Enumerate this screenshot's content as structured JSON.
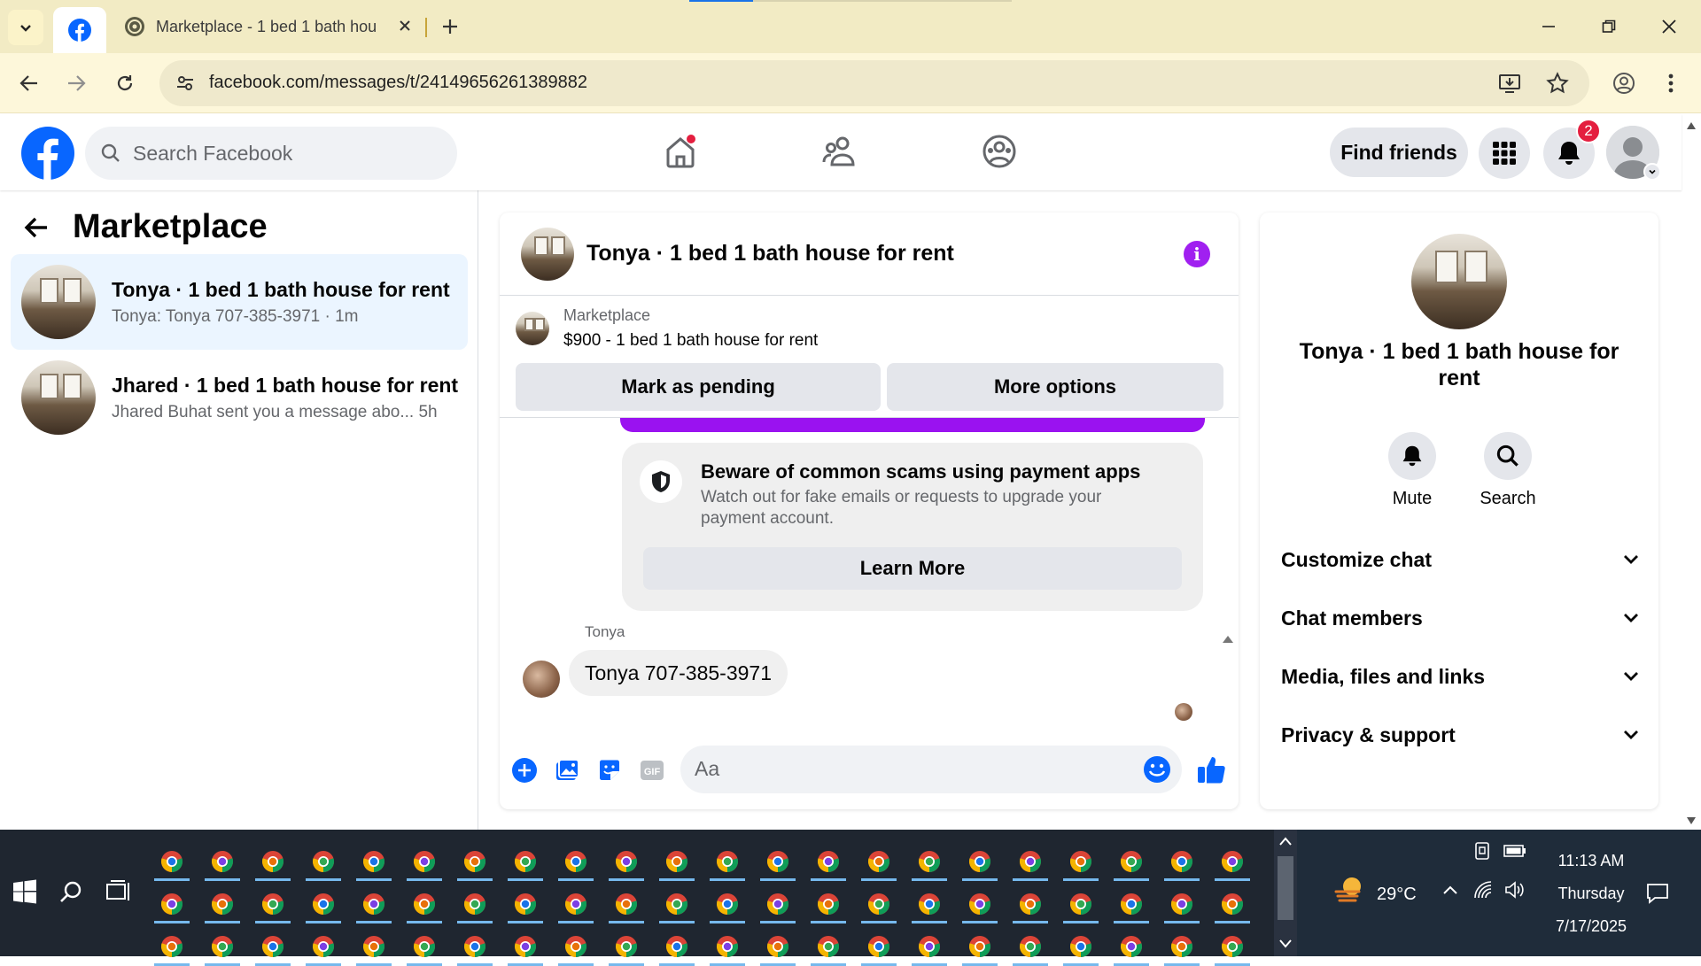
{
  "browser": {
    "tabs": [
      {
        "title": "",
        "icon": "facebook-icon"
      },
      {
        "title": "Marketplace - 1 bed 1 bath hou",
        "icon": "marketplace-favicon"
      }
    ],
    "url": "facebook.com/messages/t/24149656261389882"
  },
  "fb_header": {
    "search_placeholder": "Search Facebook",
    "find_friends_label": "Find friends",
    "notification_count": "2"
  },
  "left_panel": {
    "title": "Marketplace",
    "conversations": [
      {
        "name": "Tonya · 1 bed 1 bath house for rent",
        "preview": "Tonya: Tonya 707-385-3971 · 1m",
        "active": true
      },
      {
        "name": "Jhared · 1 bed 1 bath house for rent",
        "preview": "Jhared Buhat sent you a message abo...  5h",
        "active": false
      }
    ]
  },
  "chat": {
    "title": "Tonya · 1 bed 1 bath house for rent",
    "marketplace_label": "Marketplace",
    "listing": "$900 - 1 bed 1 bath house for rent",
    "mark_pending_label": "Mark as pending",
    "more_options_label": "More options",
    "scam_notice": {
      "heading": "Beware of common scams using payment apps",
      "body": "Watch out for fake emails or requests to upgrade your payment account.",
      "button": "Learn More"
    },
    "messages": [
      {
        "sender": "Tonya",
        "text": "Tonya 707-385-3971"
      }
    ],
    "composer_placeholder": "Aa"
  },
  "info_panel": {
    "title": "Tonya · 1 bed 1 bath house for rent",
    "actions": [
      {
        "label": "Mute",
        "icon": "bell-icon"
      },
      {
        "label": "Search",
        "icon": "search-icon"
      }
    ],
    "sections": [
      "Customize chat",
      "Chat members",
      "Media, files and links",
      "Privacy & support"
    ]
  },
  "taskbar": {
    "temperature": "29°C",
    "time": "11:13 AM",
    "day": "Thursday",
    "date": "7/17/2025"
  },
  "colors": {
    "fb_blue": "#0866ff",
    "messenger_purple": "#a020f0",
    "tab_bar": "#f2ebc4",
    "toolbar": "#fdf7da",
    "taskbar": "#1f2630"
  }
}
